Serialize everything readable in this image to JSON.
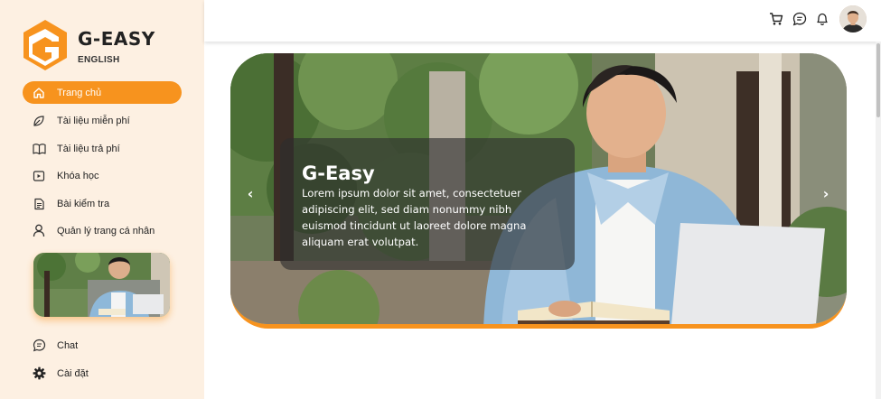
{
  "brand": {
    "name": "G-EASY",
    "sub": "ENGLISH",
    "accent": "#f7931e"
  },
  "nav": {
    "items": [
      {
        "label": "Trang chủ",
        "icon": "home-icon",
        "active": true
      },
      {
        "label": "Tài liệu miễn phí",
        "icon": "leaf-icon"
      },
      {
        "label": "Tài liệu trả phí",
        "icon": "book-icon"
      },
      {
        "label": "Khóa học",
        "icon": "video-icon"
      },
      {
        "label": "Bài kiểm tra",
        "icon": "document-icon"
      },
      {
        "label": "Quản lý trang cá nhân",
        "icon": "user-icon"
      }
    ],
    "bottom": [
      {
        "label": "Chat",
        "icon": "chat-icon"
      },
      {
        "label": "Cài đặt",
        "icon": "gear-icon"
      }
    ]
  },
  "header": {
    "icons": [
      "cart-icon",
      "message-icon",
      "bell-icon"
    ],
    "avatar": "user-avatar"
  },
  "hero": {
    "title": "G-Easy",
    "body": "Lorem ipsum dolor sit amet, consectetuer adipiscing elit, sed diam nonummy nibh euismod tincidunt ut laoreet dolore magna aliquam erat volutpat.",
    "prev": "‹",
    "next": "›"
  }
}
